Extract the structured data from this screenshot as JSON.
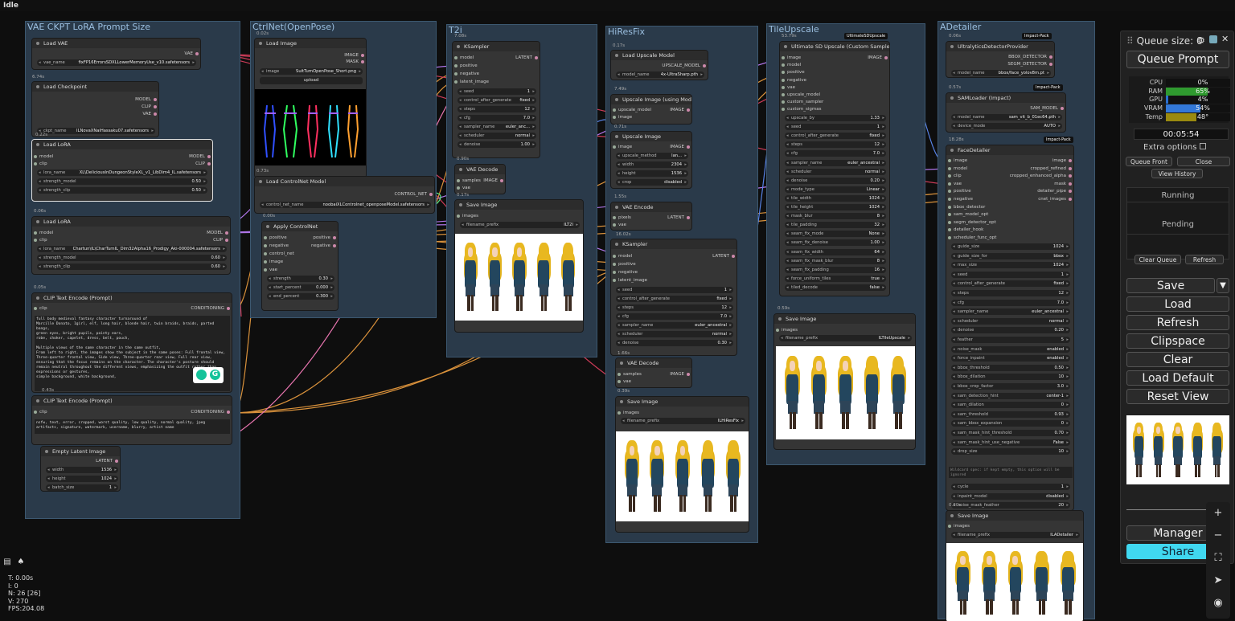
{
  "window": {
    "status": "Idle"
  },
  "groups": [
    "VAE CKPT LoRA Prompt Size",
    "CtrlNet(OpenPose)",
    "T2i",
    "HiResFix",
    "TileUpscale",
    "ADetailer"
  ],
  "nodes": {
    "load_vae": {
      "title": "Load VAE",
      "out": "VAE",
      "wname": "vae_name",
      "wval": "fixFP16ErrorsSDXLLowerMemoryUse_v10.safetensors"
    },
    "load_ckpt": {
      "time": "6.74s",
      "title": "Load Checkpoint",
      "o0": "MODEL",
      "o1": "CLIP",
      "o2": "VAE",
      "wname": "ckpt_name",
      "wval": "ILNovaXNaiHassaku07.safetensors"
    },
    "lora1": {
      "time": "0.22s",
      "title": "Load LoRA",
      "i0": "model",
      "i1": "clip",
      "o0": "MODEL",
      "o1": "CLIP",
      "w0n": "lora_name",
      "w0v": "XL\\DeliciousInDungeonStyleXL_v1_LibDim4_IL.safetensors",
      "w1n": "strength_model",
      "w1v": "0.50",
      "w2n": "strength_clip",
      "w2v": "0.50"
    },
    "lora2": {
      "time": "0.06s",
      "title": "Load LoRA",
      "i0": "model",
      "i1": "clip",
      "o0": "MODEL",
      "o1": "CLIP",
      "w0n": "lora_name",
      "w0v": "Chartun\\IL\\CharTurnIL_Dim32Alpha16_Prodigy_Aki-000004.safetensors",
      "w1n": "strength_model",
      "w1v": "0.60",
      "w2n": "strength_clip",
      "w2v": "0.60"
    },
    "clip1": {
      "time": "0.05s",
      "title": "CLIP Text Encode (Prompt)",
      "i0": "clip",
      "o0": "CONDITIONING",
      "text": "full body medieval fantasy character turnaround of\nMarcille Donato, 1girl, elf, long hair, blonde hair, twin braids, braids, parted bangs,\ngreen eyes, bright pupils, pointy ears,\nrobe, choker, capelet, dress, belt, pouch,\n\nMultiple views of the same character in the same outfit,\nFrom left to right, the images show the subject in the same poses: Full frontal view,\nThree-quarter frontal view, Side view, Three-quarter rear view, Full rear view,\nensuring that the focus remains on the character. The character's posture should\nremain neutral throughout the different views, emphasizing the outfit rather than\nexpressions or gestures,\nsimple background, white background,"
    },
    "clip2": {
      "time": "0.43s",
      "title": "CLIP Text Encode (Prompt)",
      "i0": "clip",
      "o0": "CONDITIONING",
      "text": "nsfw, text, error, cropped, worst quality, low quality, normal quality, jpeg\nartifacts, signature, watermark, username, blurry, artist name"
    },
    "latent": {
      "title": "Empty Latent Image",
      "o0": "LATENT",
      "w0n": "width",
      "w0v": "1536",
      "w1n": "height",
      "w1v": "1024",
      "w2n": "batch_size",
      "w2v": "1"
    },
    "loadimg": {
      "time": "0.02s",
      "title": "Load Image",
      "o0": "IMAGE",
      "o1": "MASK",
      "w0n": "image",
      "w0v": "SuitTurnOpenPose_Short.png",
      "upload": "upload"
    },
    "loadcn": {
      "time": "0.73s",
      "title": "Load ControlNet Model",
      "o0": "CONTROL_NET",
      "w0n": "control_net_name",
      "w0v": "noobaiXLControlnet_openposeModel.safetensors"
    },
    "applycn": {
      "time": "0.00s",
      "title": "Apply ControlNet",
      "i0": "positive",
      "i1": "negative",
      "i2": "control_net",
      "i3": "image",
      "i4": "vae",
      "o0": "positive",
      "o1": "negative",
      "w0n": "strength",
      "w0v": "0.30",
      "w1n": "start_percent",
      "w1v": "0.000",
      "w2n": "end_percent",
      "w2v": "0.300"
    },
    "ks1": {
      "time": "7.08s",
      "title": "KSampler",
      "i0": "model",
      "i1": "positive",
      "i2": "negative",
      "i3": "latent_image",
      "o0": "LATENT",
      "w0n": "seed",
      "w0v": "1",
      "w1n": "control_after_generate",
      "w1v": "fixed",
      "w2n": "steps",
      "w2v": "12",
      "w3n": "cfg",
      "w3v": "7.0",
      "w4n": "sampler_name",
      "w4v": "euler_anc...",
      "w5n": "scheduler",
      "w5v": "normal",
      "w6n": "denoise",
      "w6v": "1.00"
    },
    "vd1": {
      "time": "0.90s",
      "title": "VAE Decode",
      "i0": "samples",
      "i1": "vae",
      "o0": "IMAGE"
    },
    "save1": {
      "time": "0.17s",
      "title": "Save Image",
      "i0": "images",
      "w0n": "filename_prefix",
      "w0v": "ILT2I"
    },
    "lum": {
      "time": "0.17s",
      "title": "Load Upscale Model",
      "o0": "UPSCALE_MODEL",
      "w0n": "model_name",
      "w0v": "4x-UltraSharp.pth"
    },
    "uium": {
      "time": "7.49s",
      "title": "Upscale Image (using Model)",
      "i0": "upscale_model",
      "i1": "image",
      "o0": "IMAGE"
    },
    "ui": {
      "time": "0.71s",
      "title": "Upscale Image",
      "i0": "image",
      "o0": "IMAGE",
      "w0n": "upscale_method",
      "w0v": "lan...",
      "w1n": "width",
      "w1v": "2304",
      "w2n": "height",
      "w2v": "1536",
      "w3n": "crop",
      "w3v": "disabled"
    },
    "ve": {
      "time": "1.55s",
      "title": "VAE Encode",
      "i0": "pixels",
      "i1": "vae",
      "o0": "LATENT"
    },
    "ks2": {
      "time": "16.02s",
      "title": "KSampler",
      "i0": "model",
      "i1": "positive",
      "i2": "negative",
      "i3": "latent_image",
      "o0": "LATENT",
      "w0n": "seed",
      "w0v": "1",
      "w1n": "control_after_generate",
      "w1v": "fixed",
      "w2n": "steps",
      "w2v": "12",
      "w3n": "cfg",
      "w3v": "7.0",
      "w4n": "sampler_name",
      "w4v": "euler_ancestral",
      "w5n": "scheduler",
      "w5v": "normal",
      "w6n": "denoise",
      "w6v": "0.30"
    },
    "vd2": {
      "time": "1.66s",
      "title": "VAE Decode",
      "i0": "samples",
      "i1": "vae",
      "o0": "IMAGE"
    },
    "save2": {
      "time": "0.39s",
      "title": "Save Image",
      "i0": "images",
      "w0n": "filename_prefix",
      "w0v": "ILHiResFix"
    },
    "usd": {
      "time": "53.79s",
      "badge": "UltimateSDUpscale",
      "title": "Ultimate SD Upscale (Custom Sample)",
      "o0": "IMAGE",
      "inputs": [
        "image",
        "model",
        "positive",
        "negative",
        "vae",
        "upscale_model",
        "custom_sampler",
        "custom_sigmas"
      ],
      "widgets": [
        [
          "upscale_by",
          "1.33"
        ],
        [
          "seed",
          "1"
        ],
        [
          "control_after_generate",
          "fixed"
        ],
        [
          "steps",
          "12"
        ],
        [
          "cfg",
          "7.0"
        ],
        [
          "sampler_name",
          "euler_ancestral"
        ],
        [
          "scheduler",
          "normal"
        ],
        [
          "denoise",
          "0.20"
        ],
        [
          "mode_type",
          "Linear"
        ],
        [
          "tile_width",
          "1024"
        ],
        [
          "tile_height",
          "1024"
        ],
        [
          "mask_blur",
          "8"
        ],
        [
          "tile_padding",
          "32"
        ],
        [
          "seam_fix_mode",
          "None"
        ],
        [
          "seam_fix_denoise",
          "1.00"
        ],
        [
          "seam_fix_width",
          "64"
        ],
        [
          "seam_fix_mask_blur",
          "8"
        ],
        [
          "seam_fix_padding",
          "16"
        ],
        [
          "force_uniform_tiles",
          "true"
        ],
        [
          "tiled_decode",
          "false"
        ]
      ]
    },
    "save3": {
      "time": "0.59s",
      "title": "Save Image",
      "i0": "images",
      "w0n": "filename_prefix",
      "w0v": "ILTileUpscale"
    },
    "ultra": {
      "time": "0.06s",
      "badge": "Impact-Pack",
      "title": "UltralyticsDetectorProvider",
      "o0": "BBOX_DETECTOR",
      "o1": "SEGM_DETECTOR",
      "w0n": "model_name",
      "w0v": "bbox/face_yolov8m.pt"
    },
    "sam": {
      "time": "0.57s",
      "badge": "Impact-Pack",
      "title": "SAMLoader (Impact)",
      "o0": "SAM_MODEL",
      "w0n": "model_name",
      "w0v": "sam_vit_b_01ec64.pth",
      "w1n": "device_mode",
      "w1v": "AUTO"
    },
    "fd": {
      "time": "18.28s",
      "badge": "Impact-Pack",
      "title": "FaceDetailer",
      "inputs": [
        "image",
        "model",
        "clip",
        "vae",
        "positive",
        "negative",
        "bbox_detector",
        "sam_model_opt",
        "segm_detector_opt",
        "detailer_hook",
        "scheduler_func_opt"
      ],
      "outputs": [
        "image",
        "cropped_refined",
        "cropped_enhanced_alpha",
        "mask",
        "detailer_pipe",
        "cnet_images"
      ],
      "widgets": [
        [
          "guide_size",
          "1024"
        ],
        [
          "guide_size_for",
          "bbox"
        ],
        [
          "max_size",
          "1024"
        ],
        [
          "seed",
          "1"
        ],
        [
          "control_after_generate",
          "fixed"
        ],
        [
          "steps",
          "12"
        ],
        [
          "cfg",
          "7.0"
        ],
        [
          "sampler_name",
          "euler_ancestral"
        ],
        [
          "scheduler",
          "normal"
        ],
        [
          "denoise",
          "0.20"
        ],
        [
          "feather",
          "5"
        ],
        [
          "noise_mask",
          "enabled"
        ],
        [
          "force_inpaint",
          "enabled"
        ],
        [
          "bbox_threshold",
          "0.50"
        ],
        [
          "bbox_dilation",
          "10"
        ],
        [
          "bbox_crop_factor",
          "3.0"
        ],
        [
          "sam_detection_hint",
          "center-1"
        ],
        [
          "sam_dilation",
          "0"
        ],
        [
          "sam_threshold",
          "0.93"
        ],
        [
          "sam_bbox_expansion",
          "0"
        ],
        [
          "sam_mask_hint_threshold",
          "0.70"
        ],
        [
          "sam_mask_hint_use_negative",
          "False"
        ],
        [
          "drop_size",
          "10"
        ]
      ],
      "wildcard": "Wildcard spec: if kept empty, this option will be ignored",
      "widgets2": [
        [
          "cycle",
          "1"
        ],
        [
          "inpaint_model",
          "disabled"
        ],
        [
          "noise_mask_feather",
          "20"
        ]
      ]
    },
    "save4": {
      "time": "0.80s",
      "title": "Save Image",
      "i0": "images",
      "w0n": "filename_prefix",
      "w0v": "ILADetailer"
    }
  },
  "panel": {
    "queue_size": "Queue size: 0",
    "queue_prompt": "Queue Prompt",
    "monitors": [
      {
        "label": "CPU",
        "value": "0%",
        "pct": 0,
        "color": "#3aa03a"
      },
      {
        "label": "RAM",
        "value": "65%",
        "pct": 65,
        "color": "#2f9a2f"
      },
      {
        "label": "GPU",
        "value": "4%",
        "pct": 4,
        "color": "#2a6fd0"
      },
      {
        "label": "VRAM",
        "value": "54%",
        "pct": 54,
        "color": "#3378d8"
      },
      {
        "label": "Temp",
        "value": "48°",
        "pct": 48,
        "color": "#9a8a10"
      }
    ],
    "timer": "00:05:54",
    "extra_options": "Extra options",
    "queue_front": "Queue Front",
    "close": "Close",
    "view_history": "View History",
    "running": "Running",
    "pending": "Pending",
    "clear_queue": "Clear Queue",
    "refresh_small": "Refresh",
    "save": "Save",
    "load": "Load",
    "refresh": "Refresh",
    "clipspace": "Clipspace",
    "clear": "Clear",
    "load_default": "Load Default",
    "reset_view": "Reset View",
    "manager": "Manager",
    "share": "Share"
  },
  "stats": {
    "t": "T: 0.00s",
    "i": "I: 0",
    "n": "N: 26 [26]",
    "v": "V: 270",
    "fps": "FPS:204.08"
  }
}
